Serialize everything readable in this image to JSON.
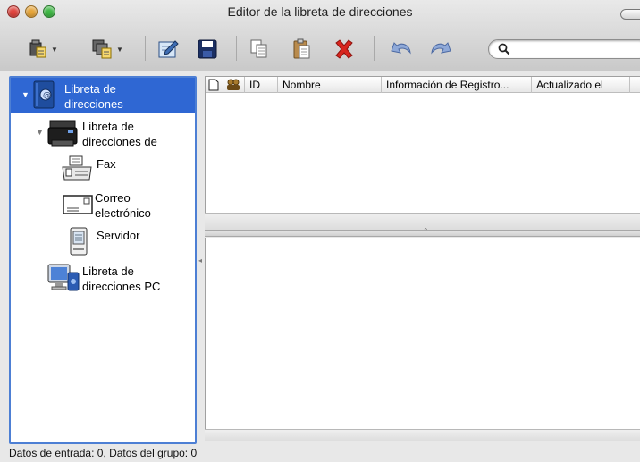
{
  "window": {
    "title": "Editor de la libreta de direcciones",
    "traffic_colors": {
      "close": "#e0443e",
      "minimize": "#e6a53a",
      "zoom": "#3fb745"
    }
  },
  "toolbar": {
    "buttons": [
      {
        "name": "new-entry",
        "icon": "new-contact-icon",
        "has_menu": true
      },
      {
        "name": "new-group",
        "icon": "new-group-icon",
        "has_menu": true
      },
      {
        "name": "edit",
        "icon": "edit-icon"
      },
      {
        "name": "save",
        "icon": "save-icon"
      },
      {
        "name": "copy",
        "icon": "copy-icon"
      },
      {
        "name": "paste",
        "icon": "paste-icon"
      },
      {
        "name": "delete",
        "icon": "delete-icon"
      },
      {
        "name": "undo",
        "icon": "undo-icon"
      },
      {
        "name": "redo",
        "icon": "redo-icon"
      }
    ],
    "search": {
      "placeholder": "",
      "value": ""
    }
  },
  "sidebar": {
    "root": {
      "label_line1": "Libreta de",
      "label_line2": "direcciones",
      "selected": true
    },
    "device": {
      "label_line1": "Libreta de",
      "label_line2": "direcciones de"
    },
    "items": [
      {
        "label_line1": "Fax",
        "label_line2": ""
      },
      {
        "label_line1": "Correo",
        "label_line2": "electrónico"
      },
      {
        "label_line1": "Servidor",
        "label_line2": ""
      }
    ],
    "pc": {
      "label_line1": "Libreta de",
      "label_line2": "direcciones PC"
    }
  },
  "table": {
    "columns": [
      "ID",
      "Nombre",
      "Información de Registro...",
      "Actualizado el"
    ],
    "rows": []
  },
  "status": {
    "text": "Datos de entrada: 0, Datos del grupo: 0"
  },
  "colors": {
    "selection": "#2f67d3",
    "sidebar_border": "#4d7fd4",
    "delete_red": "#d8261f"
  }
}
